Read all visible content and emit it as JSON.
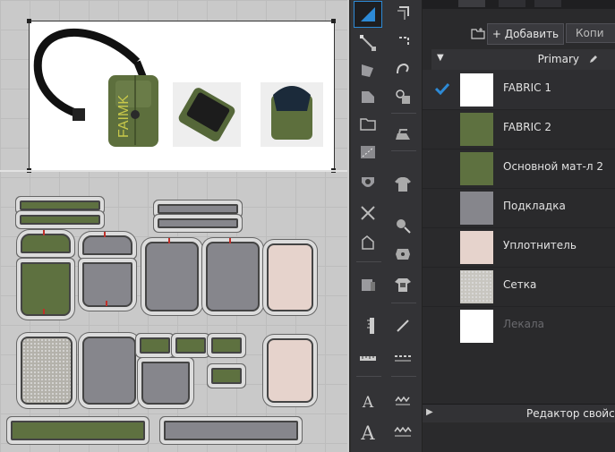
{
  "panel": {
    "add_label": "+ Добавить",
    "copy_label": "Копи",
    "group_title": "Primary",
    "properties_title": "Редактор свойств",
    "fabrics": [
      {
        "label": "FABRIC 1",
        "color": "#ffffff",
        "selected": true
      },
      {
        "label": "FABRIC 2",
        "color": "#5e7140"
      },
      {
        "label": "Основной мат-л 2",
        "color": "#5e7140"
      },
      {
        "label": "Подкладка",
        "color": "#86868c"
      },
      {
        "label": "Уплотнитель",
        "color": "#e6d3cc"
      },
      {
        "label": "Сетка",
        "color": "#c8c6c0",
        "pattern": "mesh"
      },
      {
        "label": "Лекала",
        "color": "#ffffff",
        "dim": true
      }
    ]
  },
  "colors": {
    "accent": "#2d8ad6",
    "olive": "#5e7140",
    "gray": "#86868c",
    "pink": "#e6d3cc"
  },
  "toolbar_text": {
    "text_tool": "A",
    "text_tool_large": "A"
  }
}
